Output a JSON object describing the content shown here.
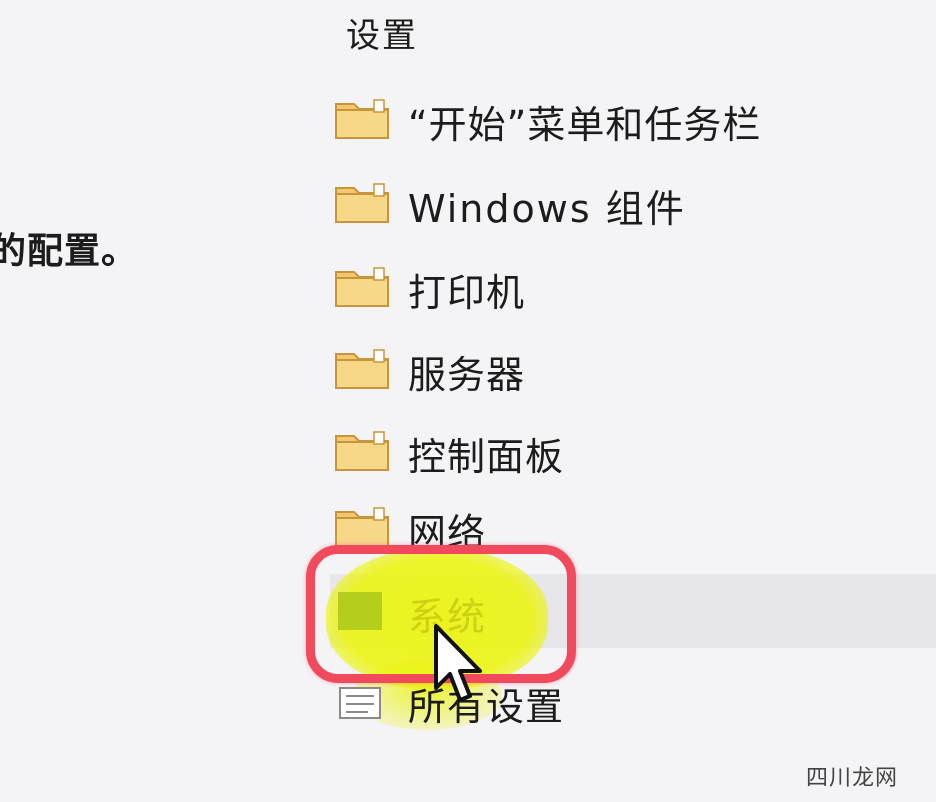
{
  "left_snippet": "的配置。",
  "tree": {
    "header": "设置",
    "items": [
      {
        "label": "“开始”菜单和任务栏",
        "icon": "folder-icon"
      },
      {
        "label": "Windows 组件",
        "icon": "folder-icon"
      },
      {
        "label": "打印机",
        "icon": "folder-icon"
      },
      {
        "label": "服务器",
        "icon": "folder-icon"
      },
      {
        "label": "控制面板",
        "icon": "folder-icon"
      },
      {
        "label": "网络",
        "icon": "folder-icon"
      },
      {
        "label": "系统",
        "icon": "folder-icon",
        "selected": true
      },
      {
        "label": "所有设置",
        "icon": "settings-list-icon"
      }
    ]
  },
  "annotation": {
    "ring_color": "#f04a5c",
    "highlight_color": "#ecf414"
  },
  "watermark": "四川龙网"
}
